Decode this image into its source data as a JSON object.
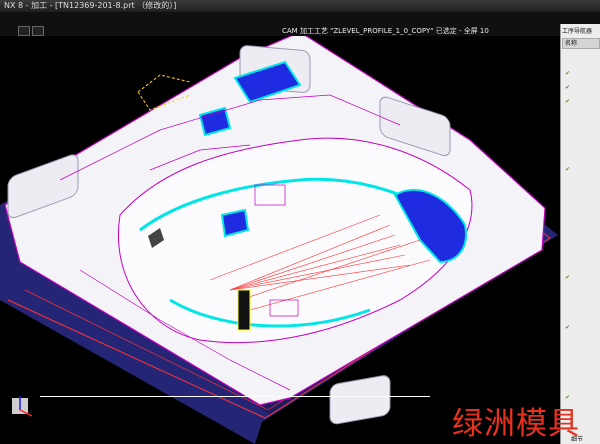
{
  "window": {
    "title": "NX 8 - 加工 - [TN12369-201-8.prt （修改的）]"
  },
  "status": {
    "text": "CAM 加工工艺 \"ZLEVEL_PROFILE_1_0_COPY\" 已选定 - 全屏 10"
  },
  "navigator": {
    "title": "工序导航器",
    "column_header": "名称",
    "bottom_label": "细节"
  },
  "watermark": {
    "text": "绿洲模具"
  },
  "colors": {
    "part_face": "#f4f3f8",
    "part_base": "#2a2a7a",
    "toolpath_red": "#ff3333",
    "toolpath_cyan": "#00e6e6",
    "edge_magenta": "#c200c2",
    "highlight_blue": "#1f2be0",
    "watermark": "#e8311f"
  }
}
